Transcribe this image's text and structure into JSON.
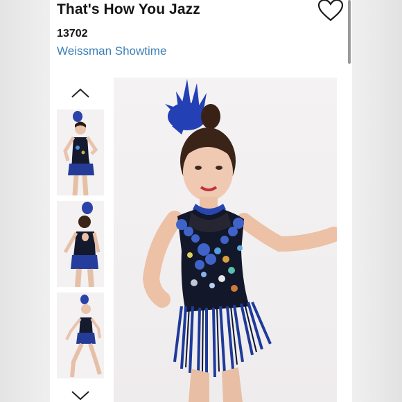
{
  "product": {
    "title": "That's How You Jazz",
    "sku": "13702",
    "brand": "Weissman Showtime"
  },
  "icons": {
    "favorite": "heart-outline-icon",
    "scroll_up": "chevron-up-icon",
    "scroll_down": "chevron-down-icon"
  },
  "colors": {
    "brand_link": "#3d7fb6",
    "costume_blue": "#1f3d9a",
    "text": "#141414"
  }
}
